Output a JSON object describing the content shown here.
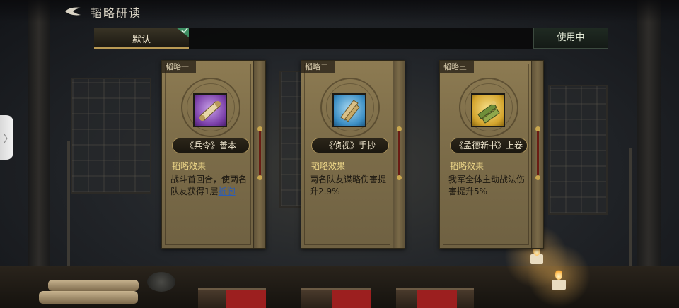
{
  "header": {
    "title": "韬略研读",
    "back_icon": "back-arrow-icon"
  },
  "tabs": {
    "default_label": "默认",
    "in_use_label": "使用中",
    "check_icon": "checkmark-icon"
  },
  "side_handle": {
    "icon": "chevron-right-icon",
    "glyph": "〉"
  },
  "cards": [
    {
      "tag": "韬略一",
      "name": "《兵令》善本",
      "icon": "purple-scroll-icon",
      "effect_title": "韬略效果",
      "effect_text": "战斗首回合，使两名队友获得1层",
      "effect_link": "抵御"
    },
    {
      "tag": "韬略二",
      "name": "《侦视》手抄",
      "icon": "blue-scroll-bundle-icon",
      "effect_title": "韬略效果",
      "effect_text": "两名队友谋略伤害提升2.9%"
    },
    {
      "tag": "韬略三",
      "name": "《孟德新书》上卷",
      "icon": "gold-scroll-bundle-icon",
      "effect_title": "韬略效果",
      "effect_text": "我军全体主动战法伤害提升5%"
    }
  ],
  "colors": {
    "accent_gold": "#b99a55",
    "effect_title": "#f0d98a",
    "link_blue": "#2a5db8"
  }
}
